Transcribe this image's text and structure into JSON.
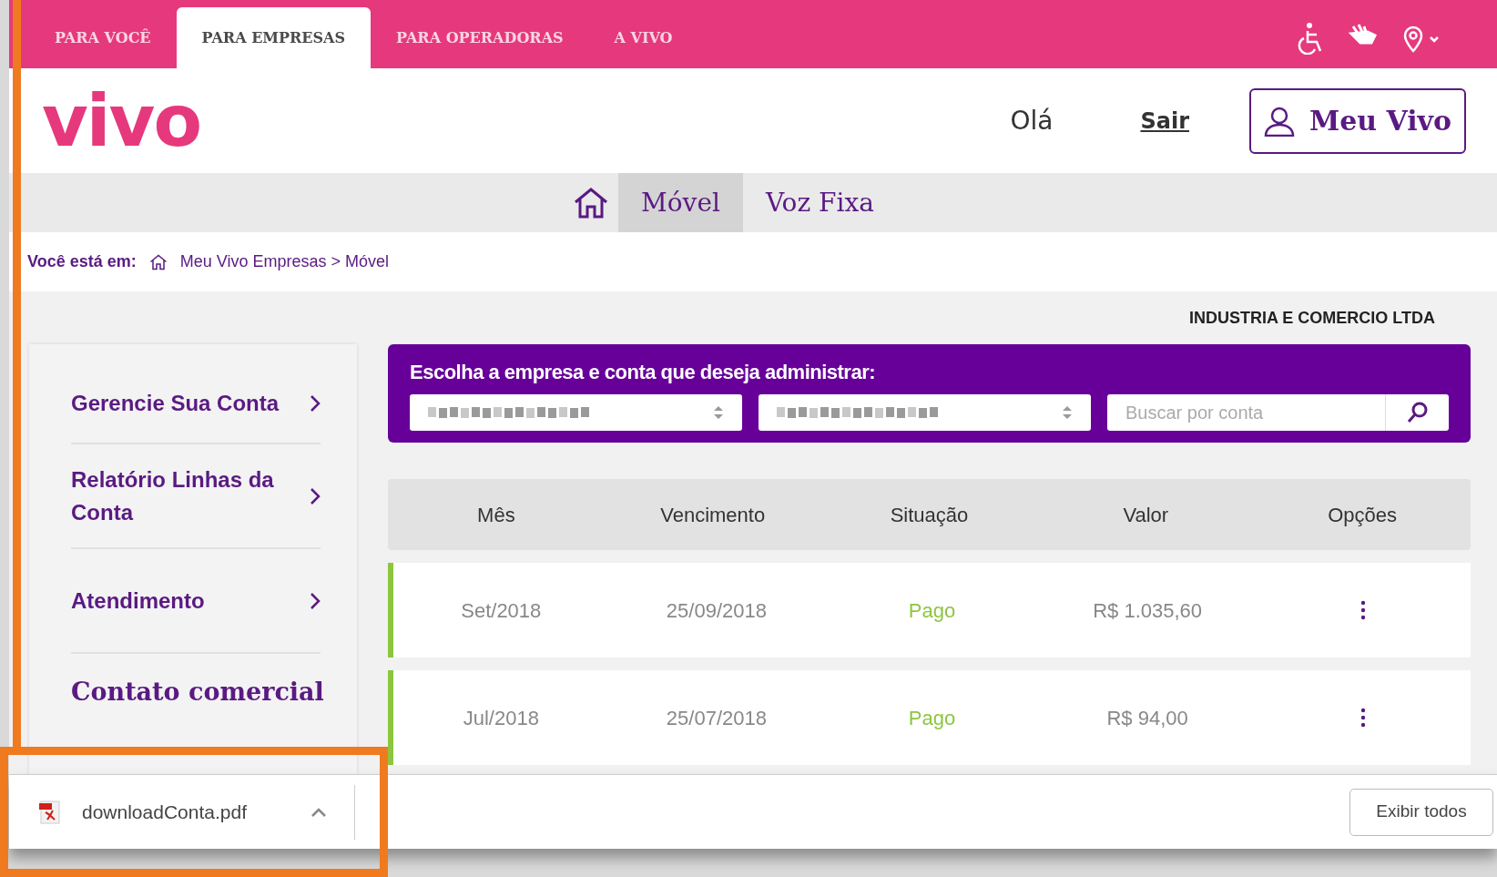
{
  "top_nav": [
    {
      "label": "PARA VOCÊ",
      "selected": false
    },
    {
      "label": "PARA EMPRESAS",
      "selected": true
    },
    {
      "label": "PARA OPERADORAS",
      "selected": false
    },
    {
      "label": "A VIVO",
      "selected": false
    }
  ],
  "header": {
    "logo": "vivo",
    "greeting": "Olá",
    "logout": "Sair",
    "account_button": "Meu Vivo"
  },
  "sub_nav": [
    {
      "label": "Móvel",
      "selected": true
    },
    {
      "label": "Voz Fixa",
      "selected": false
    }
  ],
  "breadcrumb": {
    "label": "Você está em:",
    "path": "Meu Vivo Empresas > Móvel"
  },
  "company_name": "INDUSTRIA E COMERCIO LTDA",
  "sidebar": {
    "items": [
      "Gerencie Sua Conta",
      "Relatório Linhas da Conta",
      "Atendimento"
    ],
    "contact": "Contato comercial"
  },
  "account_picker": {
    "title": "Escolha a empresa e conta que deseja administrar:",
    "search": {
      "placeholder": "Buscar por conta"
    }
  },
  "table": {
    "columns": [
      "Mês",
      "Vencimento",
      "Situação",
      "Valor",
      "Opções"
    ],
    "rows": [
      {
        "month": "Set/2018",
        "due": "25/09/2018",
        "status": "Pago",
        "value": "R$ 1.035,60",
        "color": "#8cc63f"
      },
      {
        "month": "Jul/2018",
        "due": "25/07/2018",
        "status": "Pago",
        "value": "R$ 94,00",
        "color": "#8cc63f"
      }
    ]
  },
  "download_bar": {
    "file": "downloadConta.pdf",
    "show_all": "Exibir todos"
  }
}
